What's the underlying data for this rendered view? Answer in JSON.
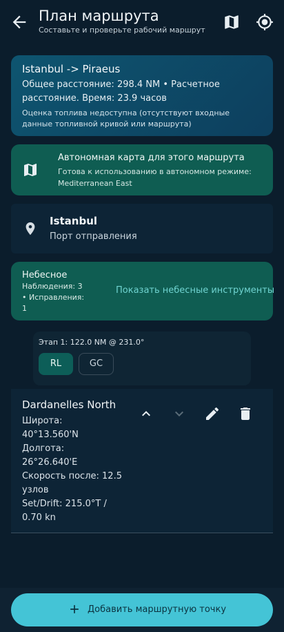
{
  "header": {
    "title": "План маршрута",
    "subtitle": "Составьте и проверьте рабочий маршрут"
  },
  "summary": {
    "route": "Istanbul -> Piraeus",
    "distance_line": "Общее расстояние: 298.4 NM • Расчетное расстояние. Время: 23.9 часов",
    "fuel_note": "Оценка топлива недоступна (отсутствуют входные данные топливной кривой или маршрута)"
  },
  "offline_map": {
    "title": "Автономная карта для этого маршрута",
    "subtitle": "Готова к использованию в автономном режиме: Mediterranean East"
  },
  "departure": {
    "name": "Istanbul",
    "label": "Порт отправления"
  },
  "celestial": {
    "title": "Небесное",
    "observations": "Наблюдения: 3",
    "fixes": "• Исправления: 1",
    "button": "Показать небесные инструменты"
  },
  "leg": {
    "text": "Этап 1: 122.0 NM @ 231.0°",
    "mode_rl": "RL",
    "mode_gc": "GC"
  },
  "waypoint": {
    "name": "Dardanelles North",
    "lat_label": "Широта:",
    "lat_value": "40°13.560'N",
    "lon_label": "Долгота:",
    "lon_value": "26°26.640'E",
    "speed_line1": "Скорость после: 12.5",
    "speed_line2": "узлов",
    "setdrift_line1": "Set/Drift: 215.0°T /",
    "setdrift_line2": "0.70 kn"
  },
  "add_button": {
    "label": "Добавить маршрутную точку"
  },
  "colors": {
    "background": "#0b1d2c",
    "summary_card": "#0e5570",
    "teal_card": "#0f5d52",
    "accent": "#44c4d6",
    "link": "#6fd3d0"
  },
  "icons": [
    "arrow-back-icon",
    "map-icon",
    "my-location-icon",
    "place-icon",
    "chevron-up-icon",
    "chevron-down-icon",
    "edit-icon",
    "delete-icon",
    "add-icon"
  ]
}
